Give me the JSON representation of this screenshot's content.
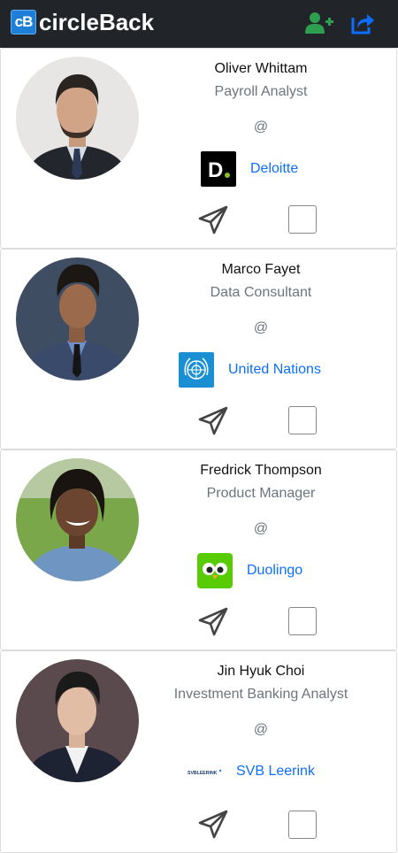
{
  "app": {
    "logo_text": "cB",
    "brand": "circleBack"
  },
  "nav": {
    "add_contact_icon": "user-plus-icon",
    "share_icon": "share-icon",
    "accent_green": "#2e9e4f",
    "accent_blue": "#0d6efd"
  },
  "contacts": [
    {
      "name": "Oliver Whittam",
      "title": "Payroll Analyst",
      "at": "@",
      "company": "Deloitte",
      "company_logo_text": "D.",
      "action_icon": "send-icon",
      "checked": false
    },
    {
      "name": "Marco Fayet",
      "title": "Data Consultant",
      "at": "@",
      "company": "United Nations",
      "company_logo_icon": "un-emblem-icon",
      "action_icon": "send-icon",
      "checked": false
    },
    {
      "name": "Fredrick Thompson",
      "title": "Product Manager",
      "at": "@",
      "company": "Duolingo",
      "company_logo_icon": "owl-icon",
      "action_icon": "send-icon",
      "checked": false
    },
    {
      "name": "Jin Hyuk Choi",
      "title": "Investment Banking Analyst",
      "at": "@",
      "company": "SVB Leerink",
      "company_logo_text": "SVBLEERINK",
      "action_icon": "send-icon",
      "checked": false
    }
  ]
}
